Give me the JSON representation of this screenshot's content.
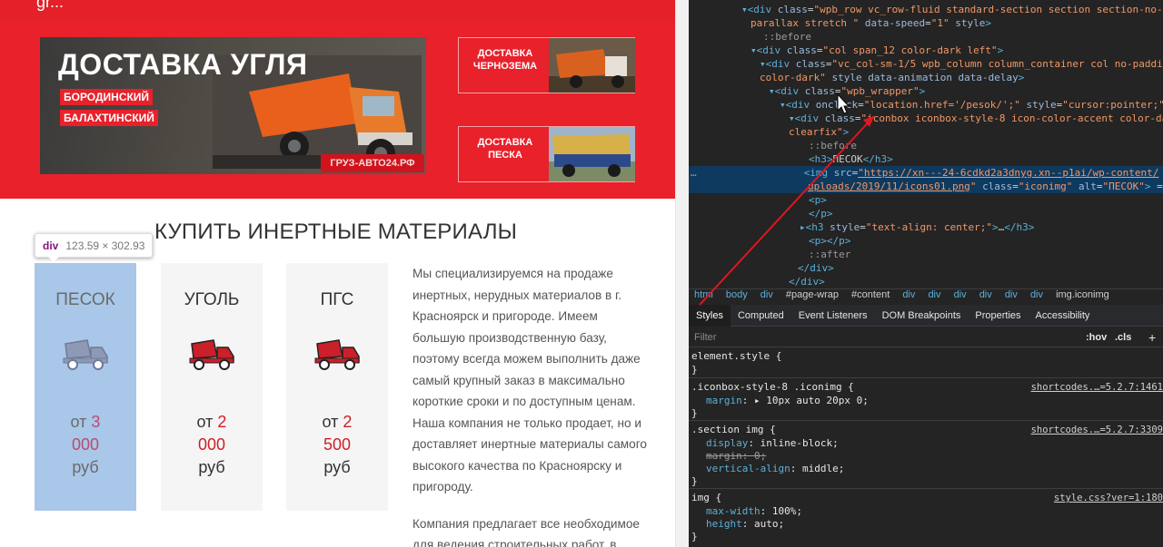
{
  "page": {
    "site_top_text": "gr...",
    "banner": {
      "title": "ДОСТАВКА УГЛЯ",
      "tag1": "БОРОДИНСКИЙ",
      "tag2": "БАЛАХТИНСКИЙ",
      "site": "ГРУЗ-АВТО24.РФ"
    },
    "side_cards": [
      {
        "label": "ДОСТАВКА ЧЕРНОЗЕМА"
      },
      {
        "label": "ДОСТАВКА ПЕСКА"
      }
    ],
    "section_title": "КУПИТЬ ИНЕРТНЫЕ МАТЕРИАЛЫ",
    "tooltip": {
      "tag": "div",
      "size": "123.59 × 302.93"
    },
    "products": [
      {
        "name": "ПЕСОК",
        "price_prefix": "от",
        "price_num_line1": "3",
        "price_num_line2": "000",
        "price_suffix": "руб"
      },
      {
        "name": "УГОЛЬ",
        "price_prefix": "от",
        "price_num_line1": "2",
        "price_num_line2": "000",
        "price_suffix": "руб"
      },
      {
        "name": "ПГС",
        "price_prefix": "от",
        "price_num_line1": "2",
        "price_num_line2": "500",
        "price_suffix": "руб"
      }
    ],
    "about": {
      "p1": "Мы специализируемся на продаже инертных, нерудных материалов в г. Красноярск и пригороде. Имеем большую производственную базу, поэтому всегда можем выполнить даже самый крупный заказ в максимально короткие сроки и по доступным ценам. Наша компания не только продает, но и доставляет инертные материалы самого высокого качества по Красноярску и пригороду.",
      "p2": "Компания предлагает все необходимое для ведения строительных работ, в"
    }
  },
  "devtools": {
    "dom_lines": [
      "▾<div class=\"wpb_row vc_row-fluid standard-section section  section-no-",
      "parallax  stretch   \" data-speed=\"1\" style>",
      "::before",
      "▾<div class=\"col span_12 color-dark left\">",
      "▾<div class=\"vc_col-sm-1/5 wpb_column column_container col no-padding",
      "color-dark\" style data-animation data-delay>",
      "▾<div class=\"wpb_wrapper\">",
      "▾<div onclick=\"location.href='/pesok/';\" style=\"cursor:pointer;\">",
      "▾<div class=\"iconbox  iconbox-style-8 icon-color-accent color-dark",
      "clearfix\">",
      "::before",
      "<h3>ПЕСОК</h3>",
      "<img src=\"https://xn---24-6cdkd2a3dnyg.xn--p1ai/wp-content/",
      "uploads/2019/11/icons01.png\" class=\"iconimg\" alt=\"ПЕСОК\"> == $0",
      "<p>",
      "</p>",
      "▸<h3 style=\"text-align: center;\">…</h3>",
      "<p></p>",
      "::after",
      "</div>",
      "</div>"
    ],
    "breadcrumb": [
      "html",
      "body",
      "div",
      "#page-wrap",
      "#content",
      "div",
      "div",
      "div",
      "div",
      "div",
      "div",
      "img.iconimg"
    ],
    "tabs": [
      "Styles",
      "Computed",
      "Event Listeners",
      "DOM Breakpoints",
      "Properties",
      "Accessibility"
    ],
    "filter": {
      "placeholder": "Filter",
      "hov": ":hov",
      "cls": ".cls",
      "plus": "+"
    },
    "rules": [
      {
        "selector": "element.style {",
        "lines": [
          "}"
        ]
      },
      {
        "selector": ".iconbox-style-8 .iconimg {",
        "source": "shortcodes.…=5.2.7:1461",
        "prop1": "margin",
        "val1": "▸ 10px auto 20px 0;"
      },
      {
        "selector": ".section img {",
        "source": "shortcodes.…=5.2.7:3309",
        "prop1": "display",
        "val1": "inline-block;",
        "prop2": "margin",
        "val2": "0;",
        "prop3": "vertical-align",
        "val3": "middle;"
      },
      {
        "selector": "img {",
        "source": "style.css?ver=1:180",
        "prop1": "max-width",
        "val1": "100%;",
        "prop2": "height",
        "val2": "auto;"
      }
    ],
    "closing_brace": "}"
  },
  "colors": {
    "brand_red": "#e8212b",
    "highlight_blue": "#a9c7e8",
    "devtools_bg": "#242424",
    "devtools_selected": "#0f3a5f",
    "arrow_red": "#e0161f"
  }
}
